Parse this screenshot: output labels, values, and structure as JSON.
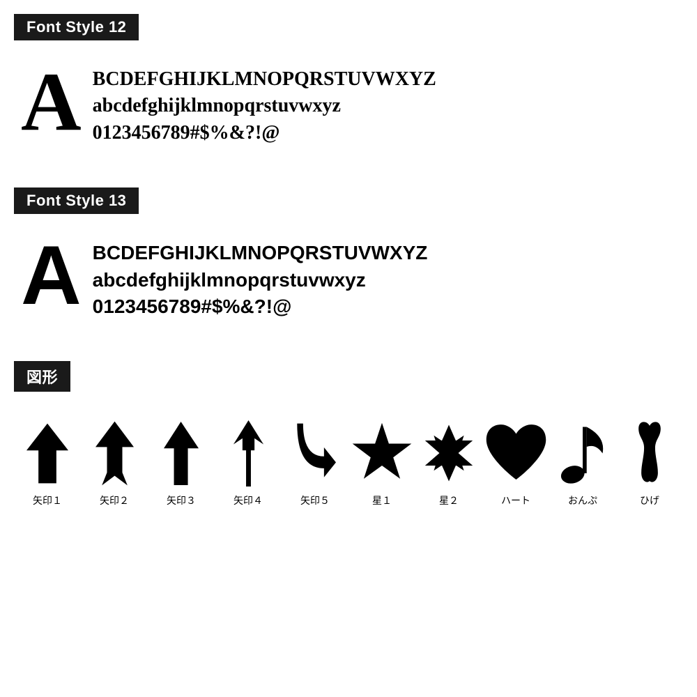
{
  "sections": {
    "font12": {
      "header": "Font Style 12",
      "big_letter": "A",
      "lines": [
        "BCDEFGHIJKLMNOPQRSTUVWXYZ",
        "abcdefghijklmnopqrstuvwxyz",
        "0123456789#$%&?!@"
      ]
    },
    "font13": {
      "header": "Font Style 13",
      "big_letter": "A",
      "lines": [
        "BCDEFGHIJKLMNOPQRSTUVWXYZ",
        "abcdefghijklmnopqrstuvwxyz",
        "0123456789#$%&?!@"
      ]
    },
    "shapes": {
      "header": "図形",
      "items": [
        {
          "label": "矢印１",
          "icon": "arrow1"
        },
        {
          "label": "矢印２",
          "icon": "arrow2"
        },
        {
          "label": "矢印３",
          "icon": "arrow3"
        },
        {
          "label": "矢印４",
          "icon": "arrow4"
        },
        {
          "label": "矢印５",
          "icon": "arrow5"
        },
        {
          "label": "星１",
          "icon": "star1"
        },
        {
          "label": "星２",
          "icon": "star2"
        },
        {
          "label": "ハート",
          "icon": "heart"
        },
        {
          "label": "おんぷ",
          "icon": "music"
        },
        {
          "label": "ひげ",
          "icon": "mustache"
        }
      ]
    }
  }
}
